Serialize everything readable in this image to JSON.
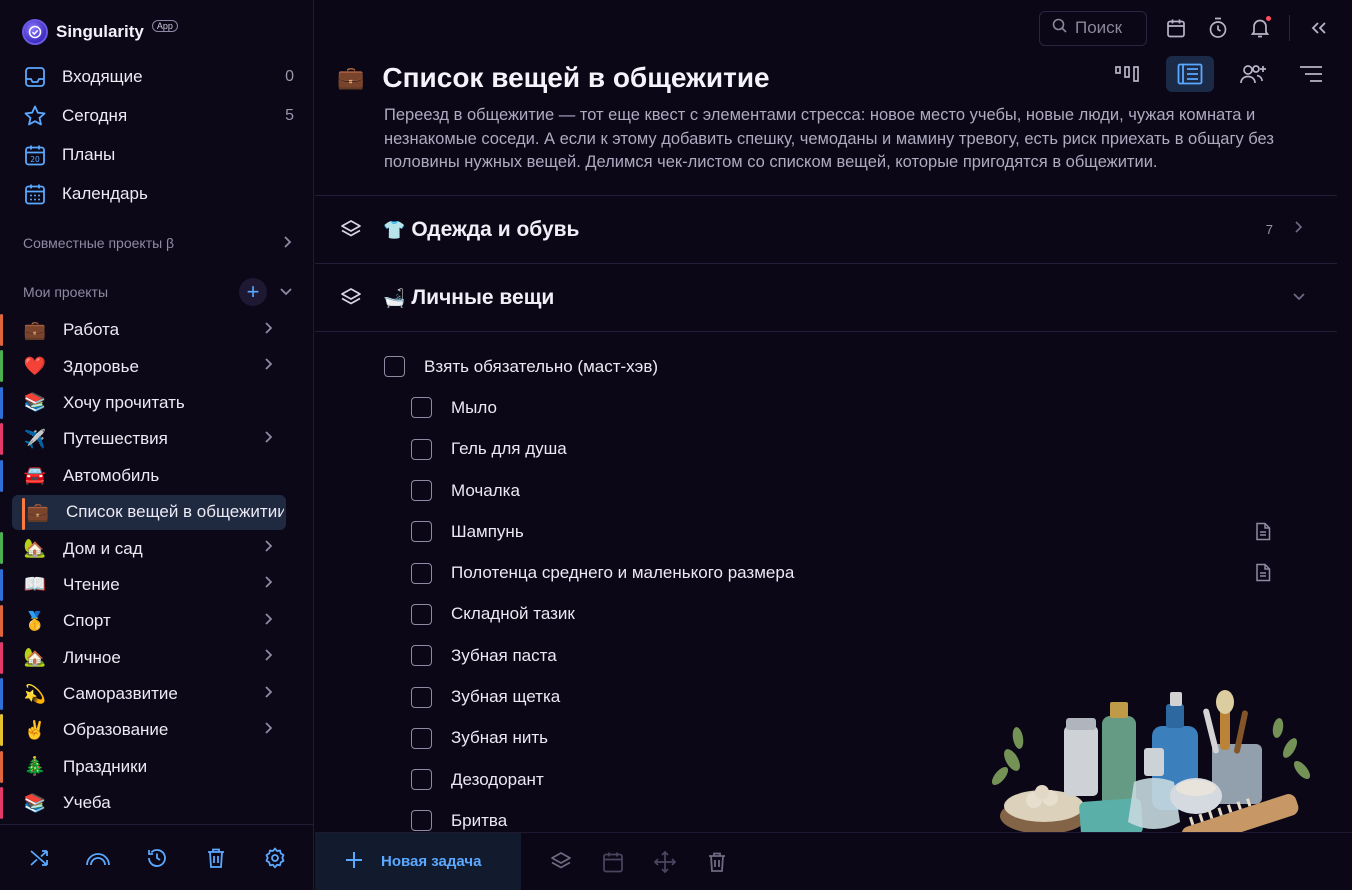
{
  "app": {
    "name": "Singularity",
    "badge": "App"
  },
  "nav": [
    {
      "label": "Входящие",
      "count": "0",
      "icon": "inbox-icon"
    },
    {
      "label": "Сегодня",
      "count": "5",
      "icon": "star-icon"
    },
    {
      "label": "Планы",
      "count": "",
      "icon": "calendar-20-icon"
    },
    {
      "label": "Календарь",
      "count": "",
      "icon": "calendar-grid-icon"
    }
  ],
  "shared_projects": {
    "label": "Совместные проекты β"
  },
  "my_projects": {
    "label": "Мои проекты"
  },
  "projects": [
    {
      "emoji": "💼",
      "label": "Работа",
      "color": "#e0643c",
      "has_children": true
    },
    {
      "emoji": "❤️",
      "label": "Здоровье",
      "color": "#4caf50",
      "has_children": true
    },
    {
      "emoji": "📚",
      "label": "Хочу прочитать",
      "color": "#2f6fd6",
      "has_children": false
    },
    {
      "emoji": "✈️",
      "label": "Путешествия",
      "color": "#e23a6a",
      "has_children": true
    },
    {
      "emoji": "🚘",
      "label": "Автомобиль",
      "color": "#2f6fd6",
      "has_children": false
    },
    {
      "emoji": "💼",
      "label": "Список вещей в общежитии",
      "color": "#ff7a3d",
      "has_children": false,
      "active": true
    },
    {
      "emoji": "🏡",
      "label": "Дом и сад",
      "color": "#4caf50",
      "has_children": true
    },
    {
      "emoji": "📖",
      "label": "Чтение",
      "color": "#2f6fd6",
      "has_children": true
    },
    {
      "emoji": "🥇",
      "label": "Спорт",
      "color": "#e0643c",
      "has_children": true
    },
    {
      "emoji": "🏡",
      "label": "Личное",
      "color": "#e23a6a",
      "has_children": true
    },
    {
      "emoji": "💫",
      "label": "Саморазвитие",
      "color": "#2f6fd6",
      "has_children": true
    },
    {
      "emoji": "✌️",
      "label": "Образование",
      "color": "#e6c22e",
      "has_children": true
    },
    {
      "emoji": "🎄",
      "label": "Праздники",
      "color": "#e0643c",
      "has_children": false
    },
    {
      "emoji": "📚",
      "label": "Учеба",
      "color": "#e23a6a",
      "has_children": false
    }
  ],
  "topbar": {
    "search_placeholder": "Поиск"
  },
  "page": {
    "emoji": "💼",
    "title": "Список вещей в общежитие",
    "description": "Переезд в общежитие — тот еще квест с элементами стресса: новое место учебы, новые люди, чужая комната и незнакомые соседи. А если к этому добавить спешку, чемоданы и мамину тревогу, есть риск приехать в общагу без половины нужных вещей. Делимся чек-листом со списком вещей, которые пригодятся в общежитии."
  },
  "groups": [
    {
      "emoji": "👕",
      "title": "Одежда и обувь",
      "count": "7",
      "expanded": false
    },
    {
      "emoji": "🛁",
      "title": "Личные вещи",
      "count": "",
      "expanded": true
    }
  ],
  "tasks": [
    {
      "label": "Взять обязательно (маст-хэв)",
      "level": "parent",
      "has_note": false
    },
    {
      "label": "Мыло",
      "level": "child",
      "has_note": false
    },
    {
      "label": "Гель для душа",
      "level": "child",
      "has_note": false
    },
    {
      "label": "Мочалка",
      "level": "child",
      "has_note": false
    },
    {
      "label": "Шампунь",
      "level": "child",
      "has_note": true
    },
    {
      "label": "Полотенца среднего и маленького размера",
      "level": "child",
      "has_note": true
    },
    {
      "label": "Складной тазик",
      "level": "child",
      "has_note": false
    },
    {
      "label": "Зубная паста",
      "level": "child",
      "has_note": false
    },
    {
      "label": "Зубная щетка",
      "level": "child",
      "has_note": false
    },
    {
      "label": "Зубная нить",
      "level": "child",
      "has_note": false
    },
    {
      "label": "Дезодорант",
      "level": "child",
      "has_note": false
    },
    {
      "label": "Бритва",
      "level": "child",
      "has_note": false
    }
  ],
  "bottom": {
    "new_task_label": "Новая задача"
  },
  "colors": {
    "accent": "#5aa8ff",
    "background": "#0b0716",
    "active_item": "#1f2940"
  }
}
